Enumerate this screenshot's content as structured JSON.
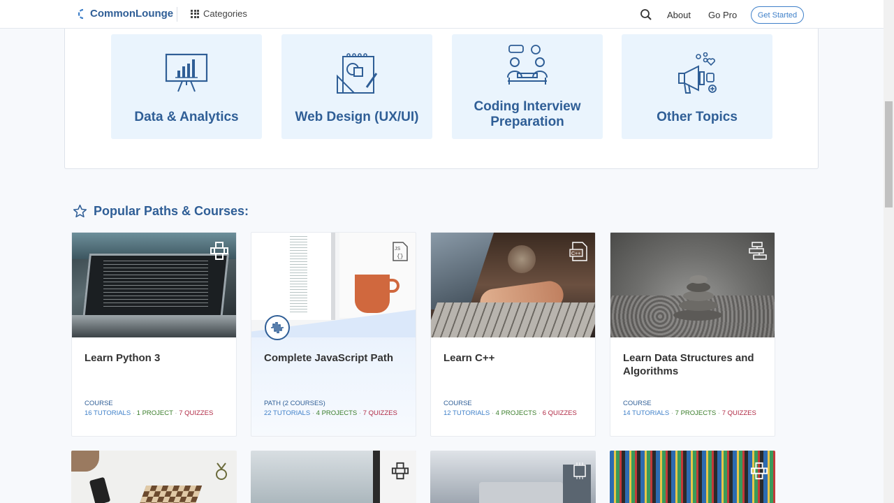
{
  "header": {
    "logo_text": "CommonLounge",
    "categories_label": "Categories",
    "about_label": "About",
    "gopro_label": "Go Pro",
    "get_started_label": "Get Started"
  },
  "categories": [
    {
      "label": "Data & Analytics",
      "icon": "presentation-chart-icon"
    },
    {
      "label": "Web Design (UX/UI)",
      "icon": "design-tools-icon"
    },
    {
      "label": "Coding Interview Preparation",
      "icon": "interview-people-icon"
    },
    {
      "label": "Other Topics",
      "icon": "megaphone-icon"
    }
  ],
  "section": {
    "title": "Popular Paths & Courses:",
    "icon": "star-icon"
  },
  "courses": [
    {
      "title": "Learn Python 3",
      "type": "COURSE",
      "tutorials": "16 TUTORIALS",
      "projects": "1 PROJECT",
      "quizzes": "7 QUIZZES",
      "icon": "python-icon"
    },
    {
      "title": "Complete JavaScript Path",
      "type": "PATH (2 COURSES)",
      "tutorials": "22 TUTORIALS",
      "projects": "4 PROJECTS",
      "quizzes": "7 QUIZZES",
      "icon": "js-file-icon"
    },
    {
      "title": "Learn C++",
      "type": "COURSE",
      "tutorials": "12 TUTORIALS",
      "projects": "4 PROJECTS",
      "quizzes": "6 QUIZZES",
      "icon": "cpp-file-icon"
    },
    {
      "title": "Learn Data Structures and Algorithms",
      "type": "COURSE",
      "tutorials": "14 TUTORIALS",
      "projects": "7 PROJECTS",
      "quizzes": "7 QUIZZES",
      "icon": "flowchart-icon"
    }
  ],
  "colors": {
    "brand": "#2f5e96",
    "accent": "#3f80c9",
    "projects": "#3a7d2a",
    "quizzes": "#b02a45",
    "category_bg": "#eaf4fd"
  }
}
